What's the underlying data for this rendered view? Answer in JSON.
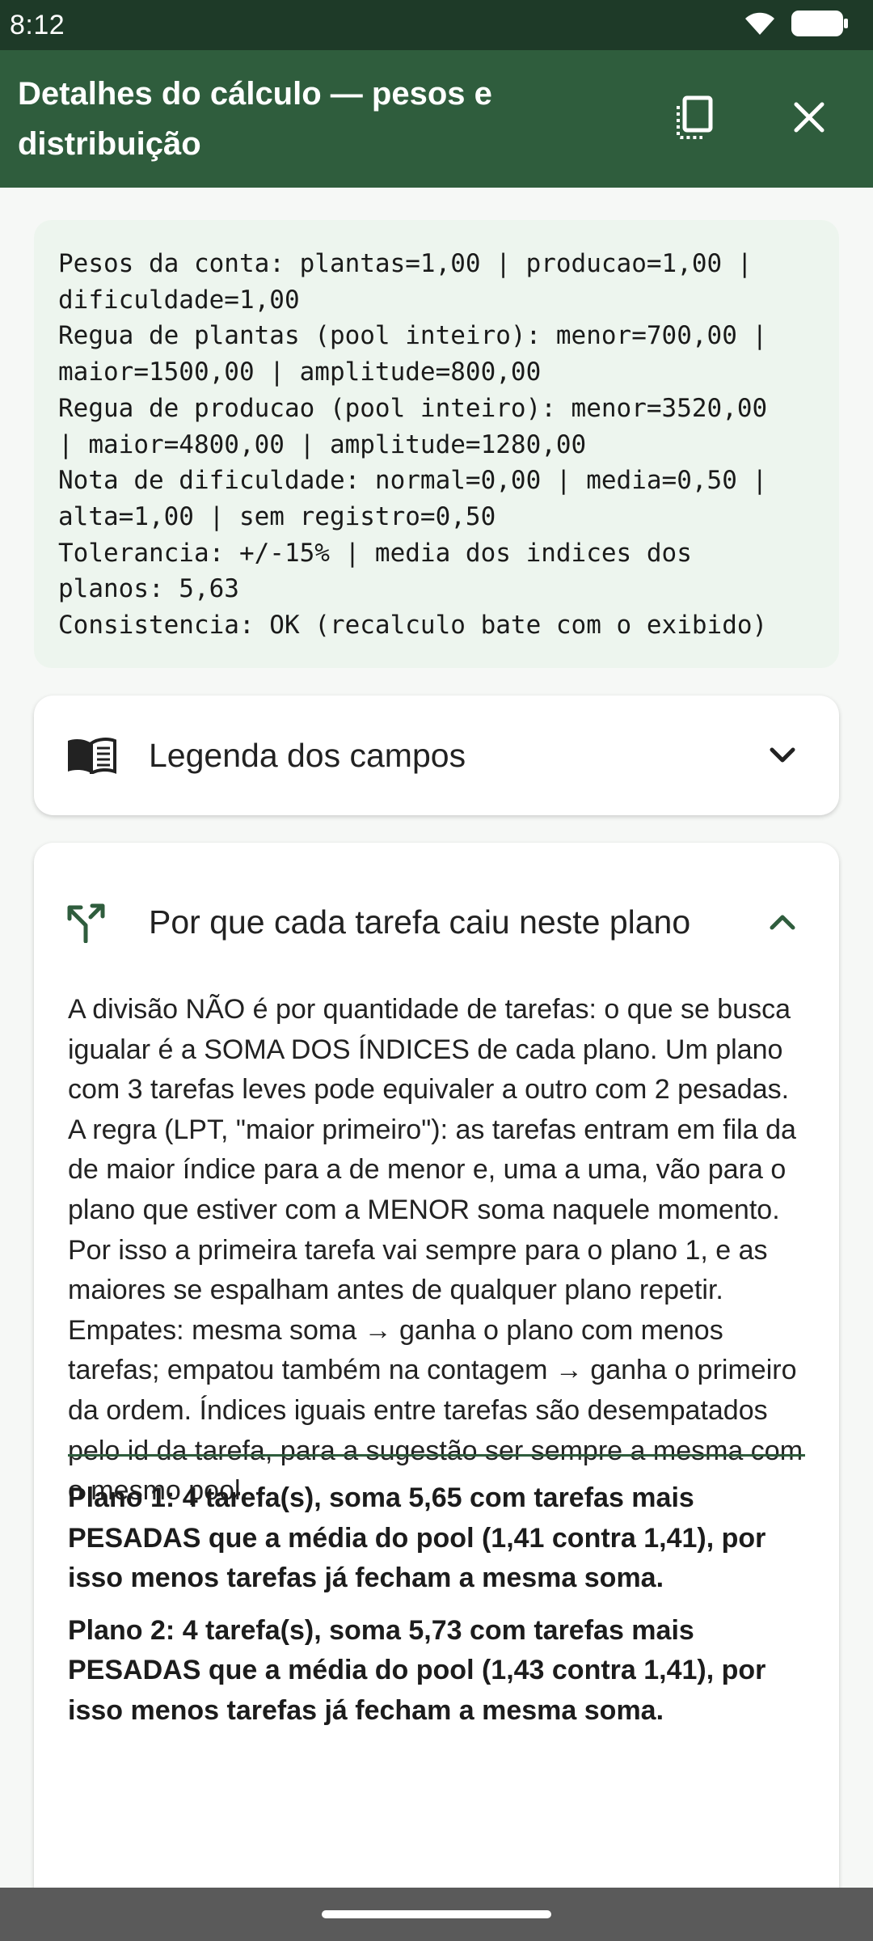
{
  "status_bar": {
    "time": "8:12"
  },
  "app_bar": {
    "title": "Detalhes do cálculo — pesos e distribuição"
  },
  "summary_lines": [
    "Pesos da conta: plantas=1,00 | producao=1,00 |",
    "dificuldade=1,00",
    "Regua de plantas (pool inteiro): menor=700,00 |",
    "maior=1500,00 | amplitude=800,00",
    "Regua de producao (pool inteiro): menor=3520,00",
    "| maior=4800,00 | amplitude=1280,00",
    "Nota de dificuldade: normal=0,00 | media=0,50 |",
    "alta=1,00 | sem registro=0,50",
    "Tolerancia: +/-15% | media dos indices dos",
    "planos: 5,63",
    "Consistencia: OK (recalculo bate com o exibido)"
  ],
  "legend_card": {
    "title": "Legenda dos campos"
  },
  "why_card": {
    "title": "Por que cada tarefa caiu neste plano",
    "paragraphs": [
      "A divisão NÃO é por quantidade de tarefas: o que se busca igualar é a SOMA DOS ÍNDICES de cada plano. Um plano com 3 tarefas leves pode equivaler a outro com 2 pesadas.",
      "A regra (LPT, \"maior primeiro\"): as tarefas entram em fila da de maior índice para a de menor e, uma a uma, vão para o plano que estiver com a MENOR soma naquele momento. Por isso a primeira tarefa vai sempre para o plano 1, e as maiores se espalham antes de qualquer plano repetir.",
      "Empates: mesma soma → ganha o plano com menos tarefas; empatou também na contagem → ganha o primeiro da ordem. Índices iguais entre tarefas são desempatados pelo id da tarefa, para a sugestão ser sempre a mesma com o mesmo pool."
    ],
    "plans": [
      "Plano 1: 4 tarefa(s), soma 5,65 com tarefas mais PESADAS que a média do pool (1,41 contra 1,41), por isso menos tarefas já fecham a mesma soma.",
      "Plano 2: 4 tarefa(s), soma 5,73 com tarefas mais PESADAS que a média do pool (1,43 contra 1,41), por isso menos tarefas já fecham a mesma soma."
    ]
  }
}
